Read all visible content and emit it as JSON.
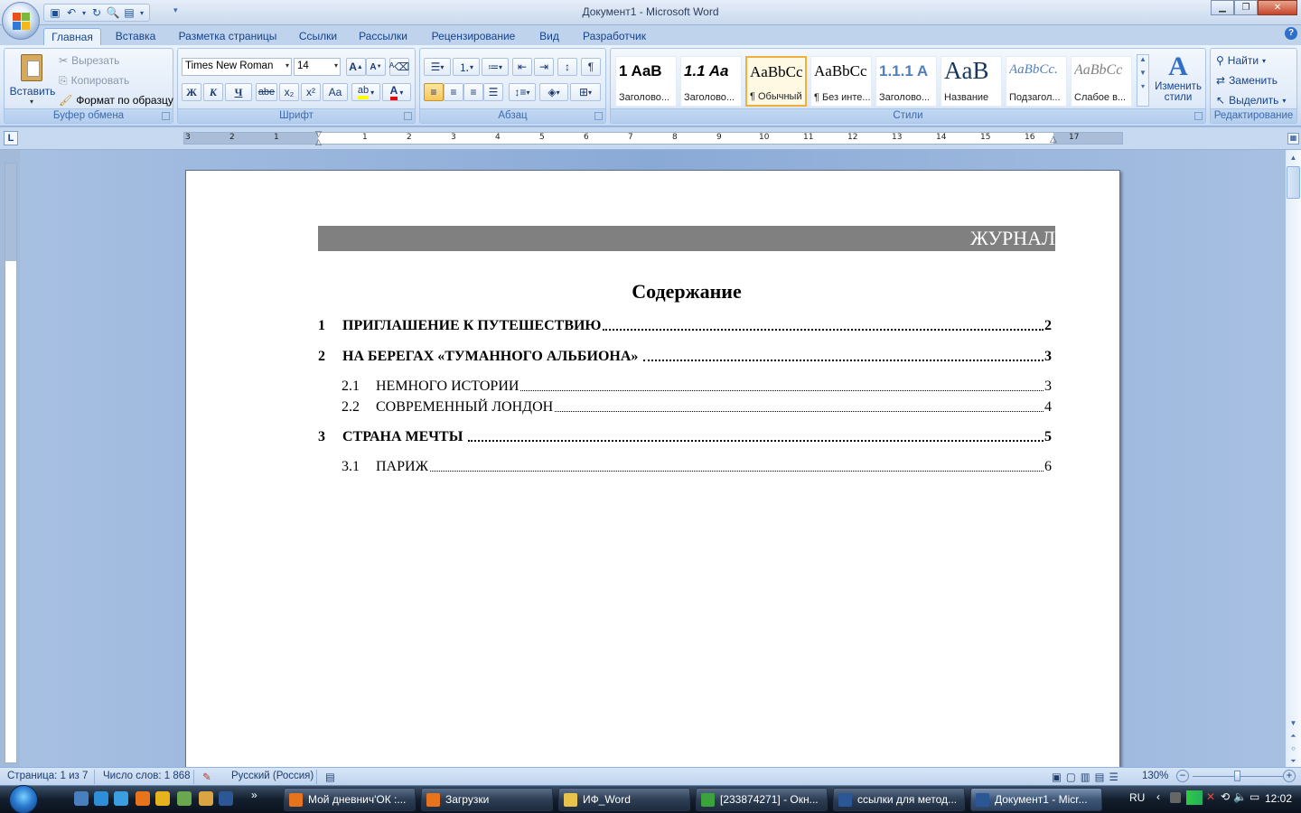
{
  "window": {
    "title": "Документ1 - Microsoft Word"
  },
  "tabs": [
    "Главная",
    "Вставка",
    "Разметка страницы",
    "Ссылки",
    "Рассылки",
    "Рецензирование",
    "Вид",
    "Разработчик"
  ],
  "clipboard": {
    "paste": "Вставить",
    "cut": "Вырезать",
    "copy": "Копировать",
    "format_painter": "Формат по образцу",
    "label": "Буфер обмена"
  },
  "font": {
    "name": "Times New Roman",
    "size": "14",
    "label": "Шрифт",
    "bold": "Ж",
    "italic": "К",
    "underline": "Ч",
    "strike": "abe",
    "sub": "x₂",
    "sup": "x²",
    "case": "Aa"
  },
  "paragraph": {
    "label": "Абзац"
  },
  "styles": {
    "label": "Стили",
    "items": [
      {
        "preview": "1 AaB",
        "name": "Заголово..."
      },
      {
        "preview": "1.1 Aa",
        "name": "Заголово..."
      },
      {
        "preview": "AaBbCc",
        "name": "¶ Обычный"
      },
      {
        "preview": "AaBbCc",
        "name": "¶ Без инте..."
      },
      {
        "preview": "1.1.1 A",
        "name": "Заголово..."
      },
      {
        "preview": "AaB",
        "name": "Название"
      },
      {
        "preview": "AaBbCc.",
        "name": "Подзагол..."
      },
      {
        "preview": "AaBbCc",
        "name": "Слабое в..."
      }
    ],
    "change": "Изменить стили"
  },
  "editing": {
    "find": "Найти",
    "replace": "Заменить",
    "select": "Выделить",
    "label": "Редактирование"
  },
  "ruler": {
    "numbers": [
      "3",
      "2",
      "1",
      "1",
      "2",
      "3",
      "4",
      "5",
      "6",
      "7",
      "8",
      "9",
      "10",
      "11",
      "12",
      "13",
      "14",
      "15",
      "16",
      "17"
    ]
  },
  "document": {
    "header": "ЖУРНАЛ",
    "toc_title": "Содержание",
    "toc": [
      {
        "num": "1",
        "title": "ПРИГЛАШЕНИЕ К ПУТЕШЕСТВИЮ",
        "page": "2",
        "level": 1
      },
      {
        "num": "2",
        "title": "НА БЕРЕГАХ «ТУМАННОГО АЛЬБИОНА»",
        "page": "3",
        "level": 1
      },
      {
        "num": "2.1",
        "title": "НЕМНОГО ИСТОРИИ",
        "page": "3",
        "level": 2
      },
      {
        "num": "2.2",
        "title": "СОВРЕМЕННЫЙ ЛОНДОН",
        "page": "4",
        "level": 2
      },
      {
        "num": "3",
        "title": "СТРАНА МЕЧТЫ",
        "page": "5",
        "level": 1
      },
      {
        "num": "3.1",
        "title": "ПАРИЖ",
        "page": "6",
        "level": 2
      }
    ]
  },
  "status": {
    "page": "Страница: 1 из 7",
    "words": "Число слов: 1 868",
    "language": "Русский (Россия)",
    "zoom": "130%"
  },
  "taskbar": {
    "items": [
      {
        "label": "Мой дневнич'ОК :...",
        "color": "#e8731d"
      },
      {
        "label": "Загрузки",
        "color": "#e8731d"
      },
      {
        "label": "ИФ_Word",
        "color": "#e7c34b"
      },
      {
        "label": "[233874271] - Окн...",
        "color": "#3ca33c"
      },
      {
        "label": "ссылки для метод...",
        "color": "#2b5797"
      },
      {
        "label": "Документ1 - Micr...",
        "color": "#2b5797"
      }
    ],
    "lang": "RU",
    "clock": "12:02"
  }
}
